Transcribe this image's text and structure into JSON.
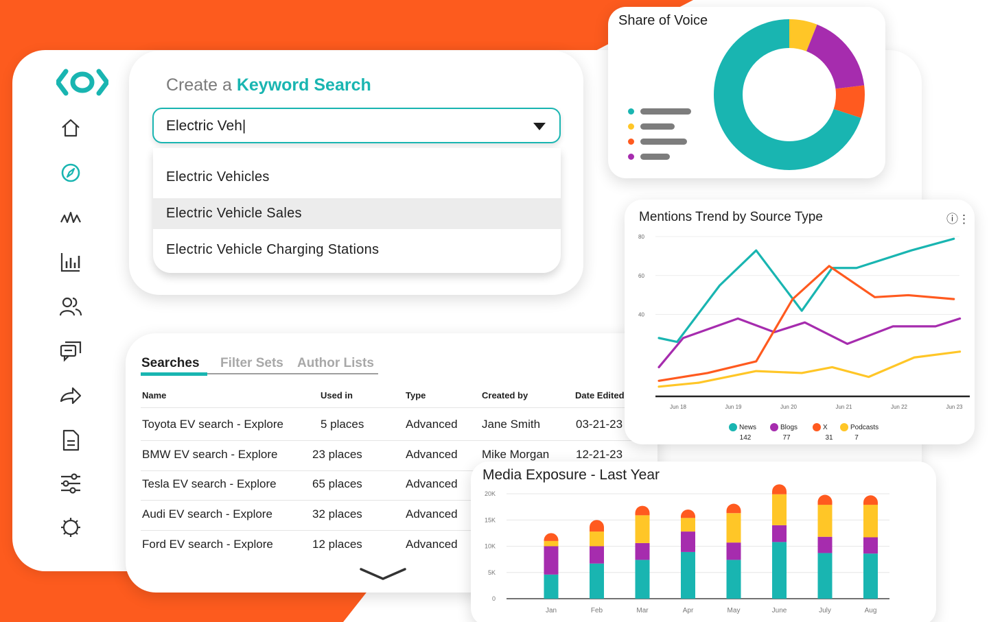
{
  "colors": {
    "teal": "#19b5b1",
    "purple": "#a62cae",
    "orange": "#ff5a1f",
    "yellow": "#ffc627",
    "brand_orange": "#fd5b1e"
  },
  "sidebar": {
    "logo": "logo-icon",
    "items": [
      {
        "icon": "home-icon"
      },
      {
        "icon": "compass-icon",
        "active": true
      },
      {
        "icon": "trend-waves-icon"
      },
      {
        "icon": "bar-chart-icon"
      },
      {
        "icon": "users-icon"
      },
      {
        "icon": "chat-icon"
      },
      {
        "icon": "share-arrow-icon"
      },
      {
        "icon": "document-icon"
      },
      {
        "icon": "sliders-icon"
      },
      {
        "icon": "gear-icon"
      }
    ]
  },
  "keyword_search": {
    "title_prefix": "Create a",
    "title_accent": "Keyword Search",
    "input_value": "Electric Veh|",
    "options": [
      "Electric Vehicles",
      "Electric Vehicle Sales",
      "Electric Vehicle Charging Stations"
    ],
    "selected_index": 1
  },
  "searches": {
    "tabs": [
      "Searches",
      "Filter Sets",
      "Author Lists"
    ],
    "columns": [
      "Name",
      "Used in",
      "Type",
      "Created by",
      "Date Edited"
    ],
    "rows": [
      [
        "Toyota EV search - Explore",
        "5 places",
        "Advanced",
        "Jane Smith",
        "03-21-23"
      ],
      [
        "BMW EV search - Explore",
        "23 places",
        "Advanced",
        "Mike Morgan",
        "12-21-23"
      ],
      [
        "Tesla EV search - Explore",
        "65 places",
        "Advanced",
        "",
        ""
      ],
      [
        "Audi EV search - Explore",
        "32 places",
        "Advanced",
        "",
        ""
      ],
      [
        "Ford EV search - Explore",
        "12 places",
        "Advanced",
        "",
        ""
      ]
    ]
  },
  "share_of_voice": {
    "title": "Share of Voice",
    "slices": [
      {
        "color": "#19b5b1",
        "value": 0.7
      },
      {
        "color": "#ffc627",
        "value": 0.06
      },
      {
        "color": "#a62cae",
        "value": 0.17
      },
      {
        "color": "#ff5a1f",
        "value": 0.07
      }
    ]
  },
  "chart_data": [
    {
      "type": "line",
      "title": "Mentions Trend by Source Type",
      "yticks": [
        "80",
        "60",
        "40"
      ],
      "x": [
        "Jun 18",
        "Jun 19",
        "Jun 20",
        "Jun 21",
        "Jun 22",
        "Jun 23"
      ],
      "ylim": [
        0,
        80
      ],
      "series": [
        {
          "name": "News",
          "total": "142",
          "color": "#19b5b1",
          "x": [
            0,
            0.3,
            1,
            1.6,
            2.35,
            2.85,
            3.25,
            4.15,
            4.85
          ],
          "values": [
            30,
            28,
            57,
            75,
            44,
            66,
            66,
            75,
            81
          ]
        },
        {
          "name": "Blogs",
          "total": "77",
          "color": "#a62cae",
          "x": [
            0,
            0.4,
            1.3,
            1.9,
            2.4,
            3.1,
            3.85,
            4.55,
            4.95
          ],
          "values": [
            15,
            30,
            40,
            33,
            38,
            27,
            36,
            36,
            40
          ]
        },
        {
          "name": "X",
          "total": "31",
          "color": "#ff5a1f",
          "x": [
            0,
            0.8,
            1.6,
            2.2,
            2.8,
            3.55,
            4.1,
            4.85
          ],
          "values": [
            8,
            12,
            18,
            50,
            67,
            51,
            52,
            50
          ]
        },
        {
          "name": "Podcasts",
          "total": "7",
          "color": "#ffc627",
          "x": [
            0,
            0.65,
            1.6,
            2.35,
            2.85,
            3.45,
            4.2,
            4.95
          ],
          "values": [
            5,
            7,
            13,
            12,
            15,
            10,
            20,
            23
          ]
        }
      ]
    },
    {
      "type": "bar",
      "title": "Media Exposure - Last Year",
      "categories": [
        "Jan",
        "Feb",
        "Mar",
        "Apr",
        "May",
        "June",
        "July",
        "Aug"
      ],
      "yticks": [
        "20K",
        "15K",
        "10K",
        "5K",
        "0"
      ],
      "ylim": [
        0,
        20000
      ],
      "series": [
        {
          "name": "teal",
          "color": "#19b5b1",
          "values": [
            4600,
            6700,
            7400,
            8900,
            7400,
            10800,
            8700,
            8600
          ]
        },
        {
          "name": "purple",
          "color": "#a62cae",
          "values": [
            5400,
            3300,
            3200,
            3900,
            3300,
            3200,
            3100,
            3100
          ]
        },
        {
          "name": "yellow",
          "color": "#ffc627",
          "values": [
            1000,
            2800,
            5300,
            2600,
            5600,
            5900,
            6100,
            6200
          ]
        },
        {
          "name": "orange",
          "color": "#ff5a1f",
          "values": [
            1500,
            2200,
            1800,
            1600,
            1800,
            1900,
            1900,
            1800
          ]
        }
      ]
    }
  ]
}
